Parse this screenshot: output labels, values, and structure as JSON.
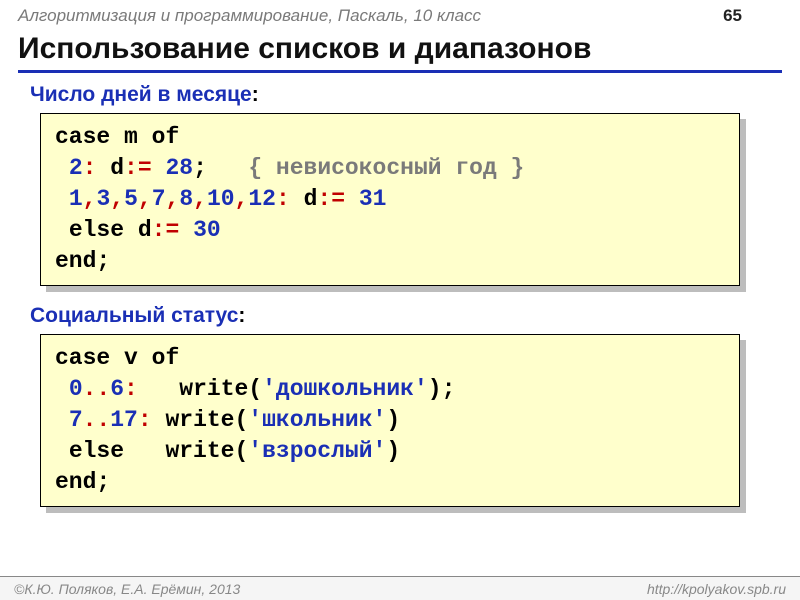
{
  "header": {
    "course": "Алгоритмизация и программирование, Паскаль, 10 класс",
    "page_number": "65"
  },
  "title": "Использование списков и диапазонов",
  "sections": [
    {
      "label": "Число дней в месяце",
      "colon": ":"
    },
    {
      "label": "Социальный статус",
      "colon": ":"
    }
  ],
  "code1": {
    "l1": {
      "kw": "case",
      "var": " m ",
      "kw2": "of"
    },
    "l2": {
      "pre": " ",
      "n1": "2",
      "op1": ":",
      "mid": " d",
      "op2": ":=",
      "sp": " ",
      "n2": "28",
      "semi": ";",
      "pad": "   ",
      "cm": "{ невисокосный год }"
    },
    "l3": {
      "pre": " ",
      "n1": "1",
      "c1": ",",
      "n2": "3",
      "c2": ",",
      "n3": "5",
      "c3": ",",
      "n4": "7",
      "c4": ",",
      "n5": "8",
      "c5": ",",
      "n6": "10",
      "c6": ",",
      "n7": "12",
      "colon": ":",
      "mid": " d",
      "asg": ":=",
      "sp": " ",
      "val": "31"
    },
    "l4": {
      "pre": " ",
      "kw": "else",
      "mid": " d",
      "asg": ":=",
      "sp": " ",
      "val": "30"
    },
    "l5": {
      "kw": "end",
      "semi": ";"
    }
  },
  "code2": {
    "l1": {
      "kw": "case",
      "var": " v ",
      "kw2": "of"
    },
    "l2": {
      "pre": " ",
      "n1": "0",
      "dd": "..",
      "n2": "6",
      "colon": ":",
      "pad": "   ",
      "fn": "write(",
      "q1": "'",
      "s": "дошкольник",
      "q2": "'",
      "cp": ")",
      "semi": ";"
    },
    "l3": {
      "pre": " ",
      "n1": "7",
      "dd": "..",
      "n2": "17",
      "colon": ":",
      "pad": " ",
      "fn": "write(",
      "q1": "'",
      "s": "школьник",
      "q2": "'",
      "cp": ")"
    },
    "l4": {
      "pre": " ",
      "kw": "else",
      "pad": "   ",
      "fn": "write(",
      "q1": "'",
      "s": "взрослый",
      "q2": "'",
      "cp": ")"
    },
    "l5": {
      "kw": "end",
      "semi": ";"
    }
  },
  "footer": {
    "left": "К.Ю. Поляков, Е.А. Ерёмин, 2013",
    "copyright": "©",
    "right": "http://kpolyakov.spb.ru"
  }
}
